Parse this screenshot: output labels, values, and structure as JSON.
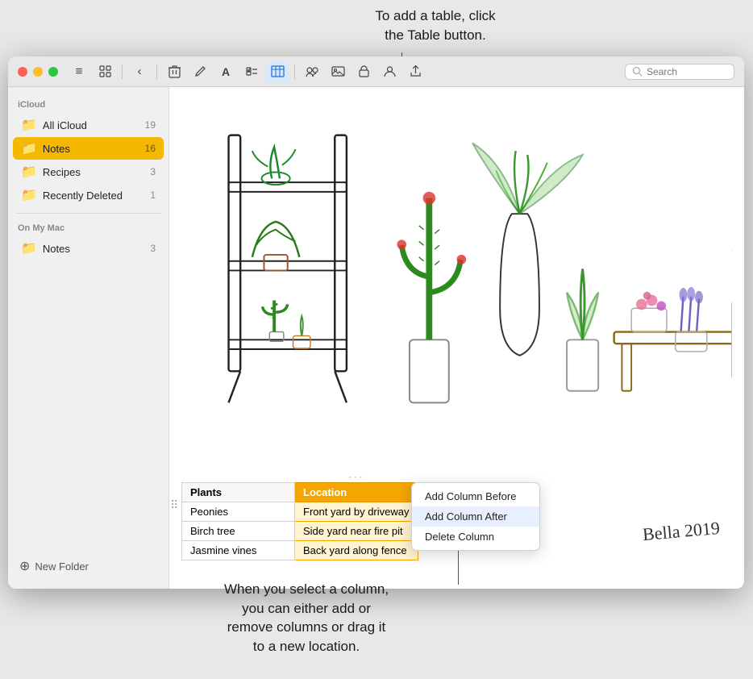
{
  "annotations": {
    "top": "To add a table, click\nthe Table button.",
    "bottom": "When you select a column,\nyou can either add or\nremove columns or drag it\nto a new location."
  },
  "window": {
    "title": "Notes"
  },
  "toolbar": {
    "buttons": [
      {
        "name": "list-view",
        "icon": "≡",
        "label": "List View"
      },
      {
        "name": "grid-view",
        "icon": "⊞",
        "label": "Grid View"
      },
      {
        "name": "back",
        "icon": "‹",
        "label": "Back"
      },
      {
        "name": "delete",
        "icon": "🗑",
        "label": "Delete"
      },
      {
        "name": "compose",
        "icon": "✏",
        "label": "New Note"
      },
      {
        "name": "font",
        "icon": "A",
        "label": "Format"
      },
      {
        "name": "checklist",
        "icon": "☑",
        "label": "Checklist"
      },
      {
        "name": "table",
        "icon": "⊞",
        "label": "Table",
        "active": true
      },
      {
        "name": "collaborate",
        "icon": "◎",
        "label": "Collaborate"
      },
      {
        "name": "photo",
        "icon": "🖼",
        "label": "Photo"
      },
      {
        "name": "lock",
        "icon": "🔒",
        "label": "Lock"
      },
      {
        "name": "share-people",
        "icon": "👤",
        "label": "Share"
      },
      {
        "name": "share",
        "icon": "⬆",
        "label": "Share Note"
      }
    ],
    "search": {
      "placeholder": "Search",
      "value": ""
    }
  },
  "sidebar": {
    "icloud_section": "iCloud",
    "items_icloud": [
      {
        "label": "All iCloud",
        "count": "19",
        "active": false
      },
      {
        "label": "Notes",
        "count": "16",
        "active": true
      },
      {
        "label": "Recipes",
        "count": "3",
        "active": false
      },
      {
        "label": "Recently Deleted",
        "count": "1",
        "active": false
      }
    ],
    "mac_section": "On My Mac",
    "items_mac": [
      {
        "label": "Notes",
        "count": "3",
        "active": false
      }
    ],
    "new_folder_label": "New Folder"
  },
  "table": {
    "columns": [
      {
        "label": "Plants",
        "selected": false
      },
      {
        "label": "Location",
        "selected": true
      }
    ],
    "rows": [
      {
        "plant": "Peonies",
        "location": "Front yard by driveway"
      },
      {
        "plant": "Birch tree",
        "location": "Side yard near fire pit"
      },
      {
        "plant": "Jasmine vines",
        "location": "Back yard along fence"
      }
    ]
  },
  "context_menu": {
    "items": [
      "Add Column Before",
      "Add Column After",
      "Delete Column"
    ]
  },
  "signature": "Bella 2019"
}
